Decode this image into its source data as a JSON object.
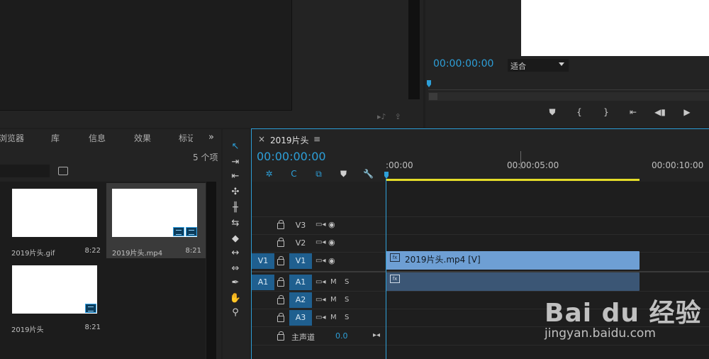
{
  "program_monitor": {
    "timecode": "00:00:00:00",
    "fit_value": "适合",
    "transport": [
      "⛊",
      "{",
      "}",
      "⇤",
      "◀▮",
      "▶",
      "▮▶"
    ]
  },
  "project_bin": {
    "tabs": [
      "浏览器",
      "库",
      "信息",
      "效果",
      "标记"
    ],
    "more": "»",
    "item_count": "5 个项",
    "items": [
      {
        "name": "2019片头.gif",
        "duration": "8:22"
      },
      {
        "name": "2019片头.mp4",
        "duration": "8:21"
      },
      {
        "name": "2019片头",
        "duration": "8:21"
      }
    ]
  },
  "timeline": {
    "tab_close": "×",
    "tab_name": "2019片头",
    "tab_menu": "≡",
    "timecode": "00:00:00:00",
    "ruler": [
      ":00:00",
      "00:00:05:00",
      "00:00:10:00"
    ],
    "tracks": {
      "v3": "V3",
      "v2": "V2",
      "v1_src": "V1",
      "v1": "V1",
      "a1_src": "A1",
      "a1": "A1",
      "a2": "A2",
      "a3": "A3",
      "mute": "M",
      "solo": "S"
    },
    "master_label": "主声道",
    "master_value": "0.0",
    "clip_video": "2019片头.mp4 [V]",
    "fx": "fx"
  },
  "watermark": {
    "brand": "Bai du 经验",
    "url": "jingyan.baidu.com"
  },
  "colors": {
    "accent": "#2d9fd8",
    "video_clip": "#6e9fd4",
    "audio_clip": "#3b5675",
    "work_area": "#e4dc28"
  }
}
